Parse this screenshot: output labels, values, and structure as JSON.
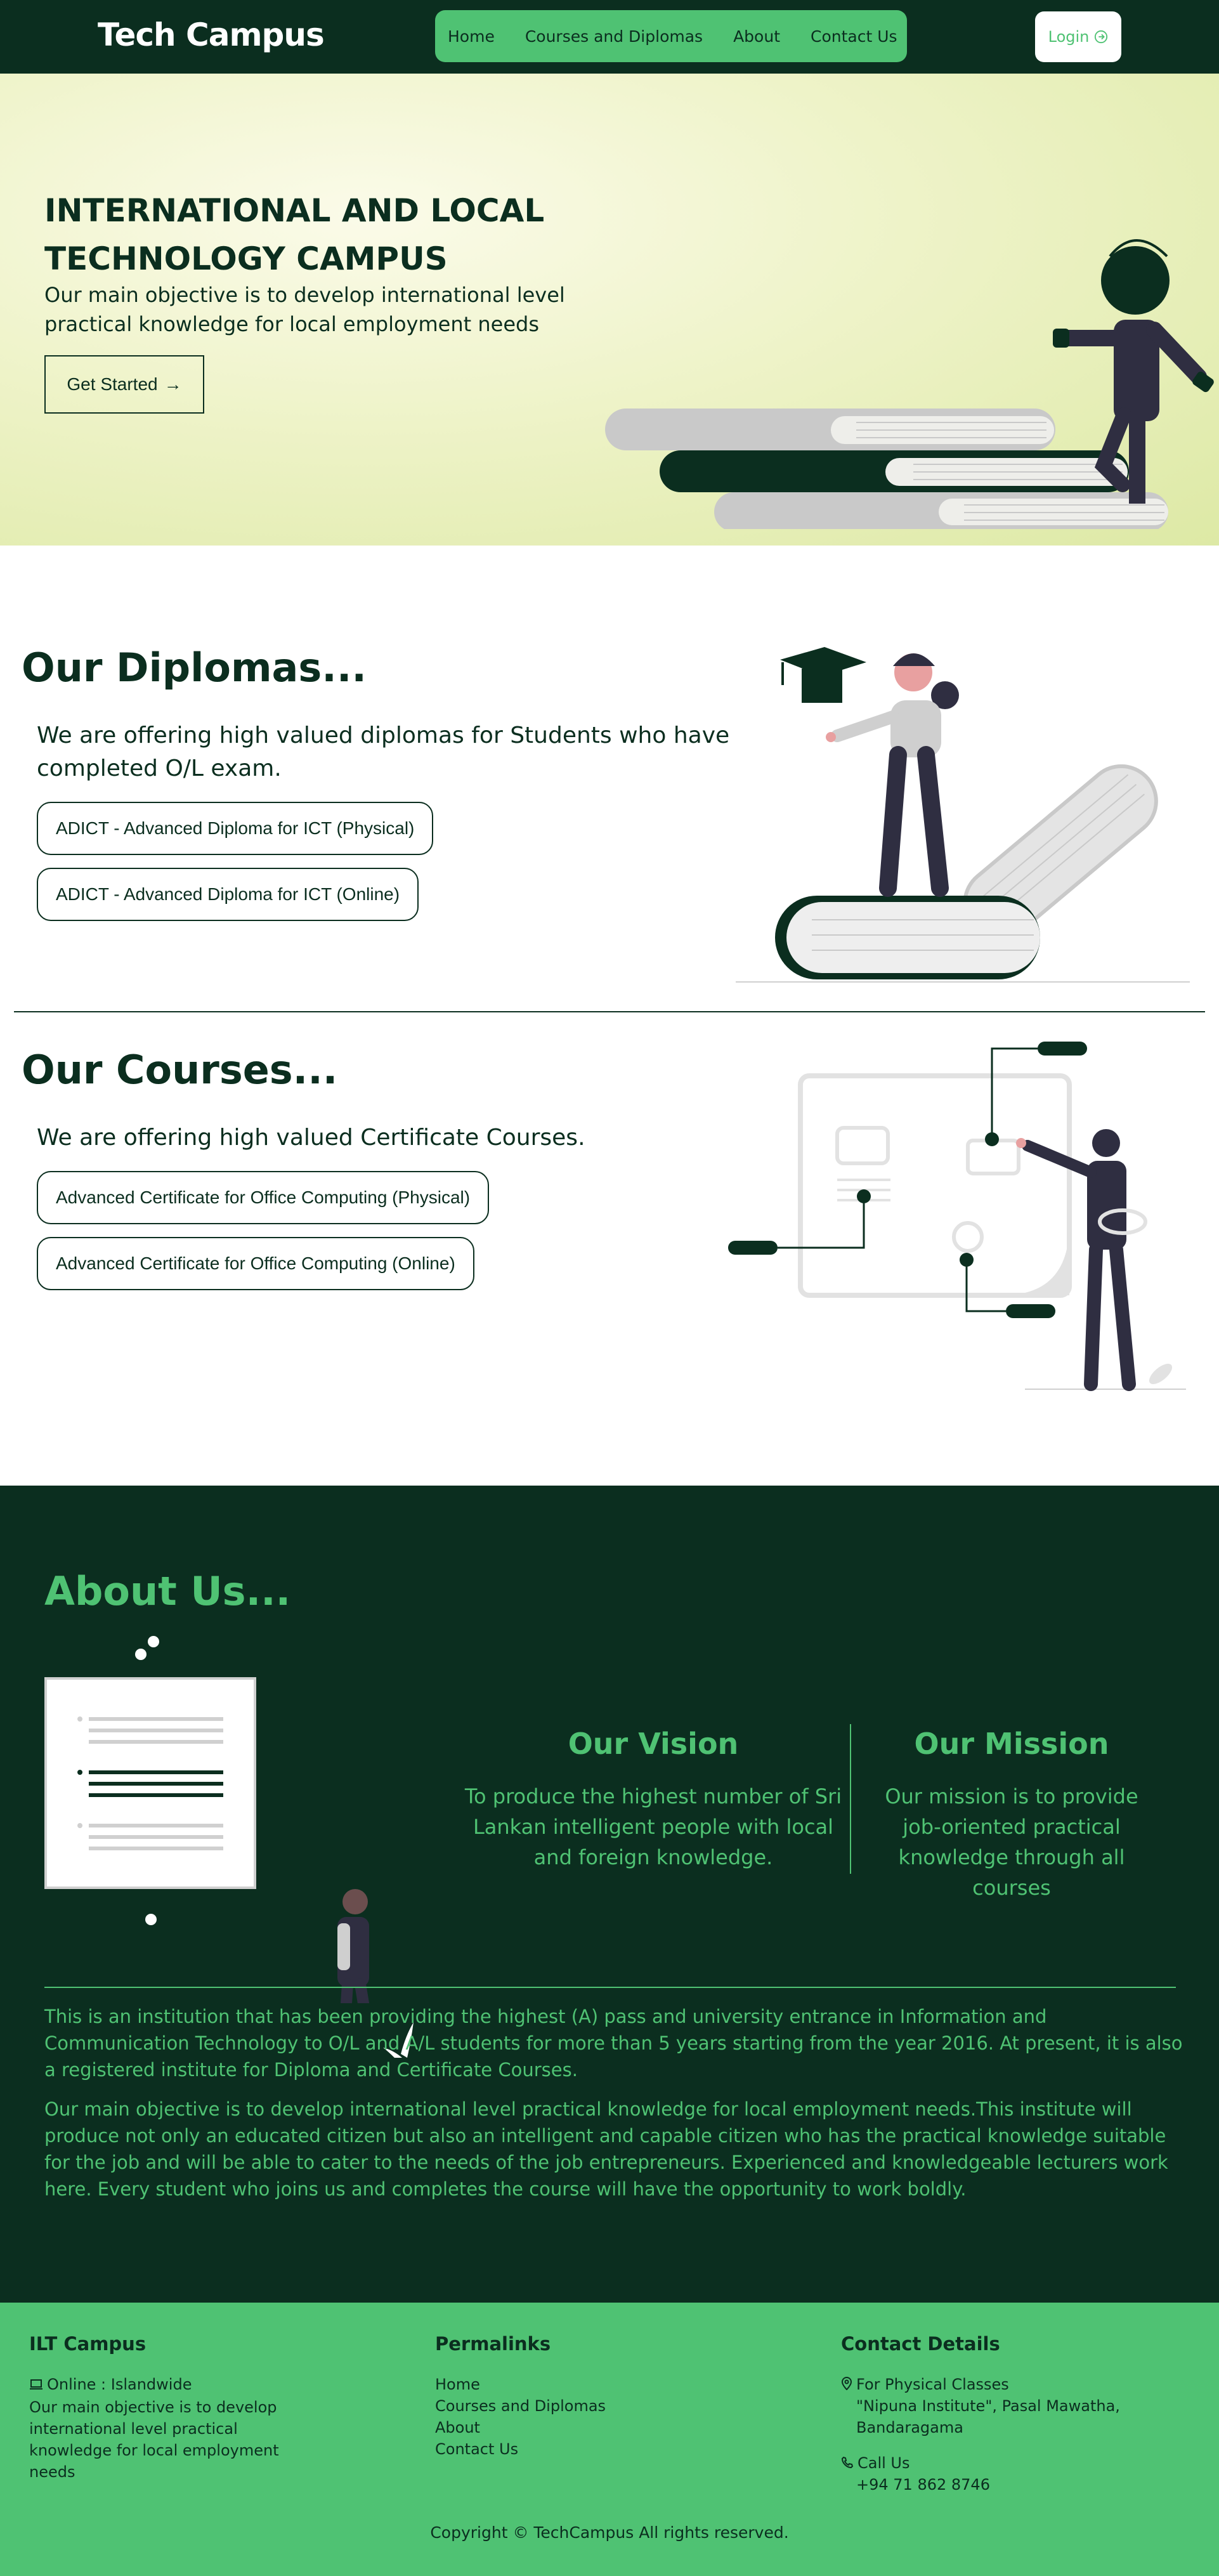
{
  "navbar": {
    "brand": "Tech Campus",
    "links": [
      "Home",
      "Courses and Diplomas",
      "About",
      "Contact Us"
    ],
    "login_label": "Login",
    "login_icon": "login-icon"
  },
  "hero": {
    "title_line1": "INTERNATIONAL AND LOCAL",
    "title_line2": "TECHNOLOGY CAMPUS",
    "subtitle": "Our main objective is to develop international level practical knowledge for local employment needs",
    "cta_label": "Get Started",
    "cta_icon": "arrow-right-icon"
  },
  "diplomas": {
    "title": "Our Diplomas...",
    "subtitle": "We are offering high valued diplomas for Students who have completed O/L exam.",
    "buttons": [
      "ADICT - Advanced Diploma for ICT (Physical)",
      "ADICT - Advanced Diploma for ICT (Online)"
    ]
  },
  "courses": {
    "title": "Our Courses...",
    "subtitle": "We are offering high valued Certificate Courses.",
    "buttons": [
      "Advanced Certificate for Office Computing (Physical)",
      "Advanced Certificate for Office Computing (Online)"
    ]
  },
  "about": {
    "title": "About Us...",
    "vision_title": "Our Vision",
    "vision_text": "To produce the highest number of Sri Lankan intelligent people with local and foreign knowledge.",
    "mission_title": "Our Mission",
    "mission_text": "Our mission is to provide job-oriented practical knowledge through all courses",
    "para1": "This is an institution that has been providing the highest (A) pass and university entrance in Information and Communication Technology to O/L and A/L students for more than 5 years starting from the year 2016. At present, it is also a registered institute for Diploma and Certificate Courses.",
    "para2": "Our main objective is to develop international level practical knowledge for local employment needs.This institute will produce not only an educated citizen but also an intelligent and capable citizen who has the practical knowledge suitable for the job and will be able to cater to the needs of the job entrepreneurs. Experienced and knowledgeable lecturers work here. Every student who joins us and completes the course will have the opportunity to work boldly."
  },
  "footer": {
    "col1_title": "ILT Campus",
    "col1_online": "Online : Islandwide",
    "col1_desc": "Our main objective is to develop international level practical knowledge for local employment needs",
    "col2_title": "Permalinks",
    "col2_links": [
      "Home",
      "Courses and Diplomas",
      "About",
      "Contact Us"
    ],
    "col3_title": "Contact Details",
    "physical_label": "For Physical Classes",
    "address": "\"Nipuna Institute\", Pasal Mawatha, Bandaragama",
    "call_label": "Call Us",
    "phone": "+94 71 862 8746",
    "copyright": "Copyright © TechCampus All rights reserved."
  },
  "colors": {
    "dark_green": "#0b2e1f",
    "accent_green": "#4fc273",
    "white": "#ffffff"
  }
}
